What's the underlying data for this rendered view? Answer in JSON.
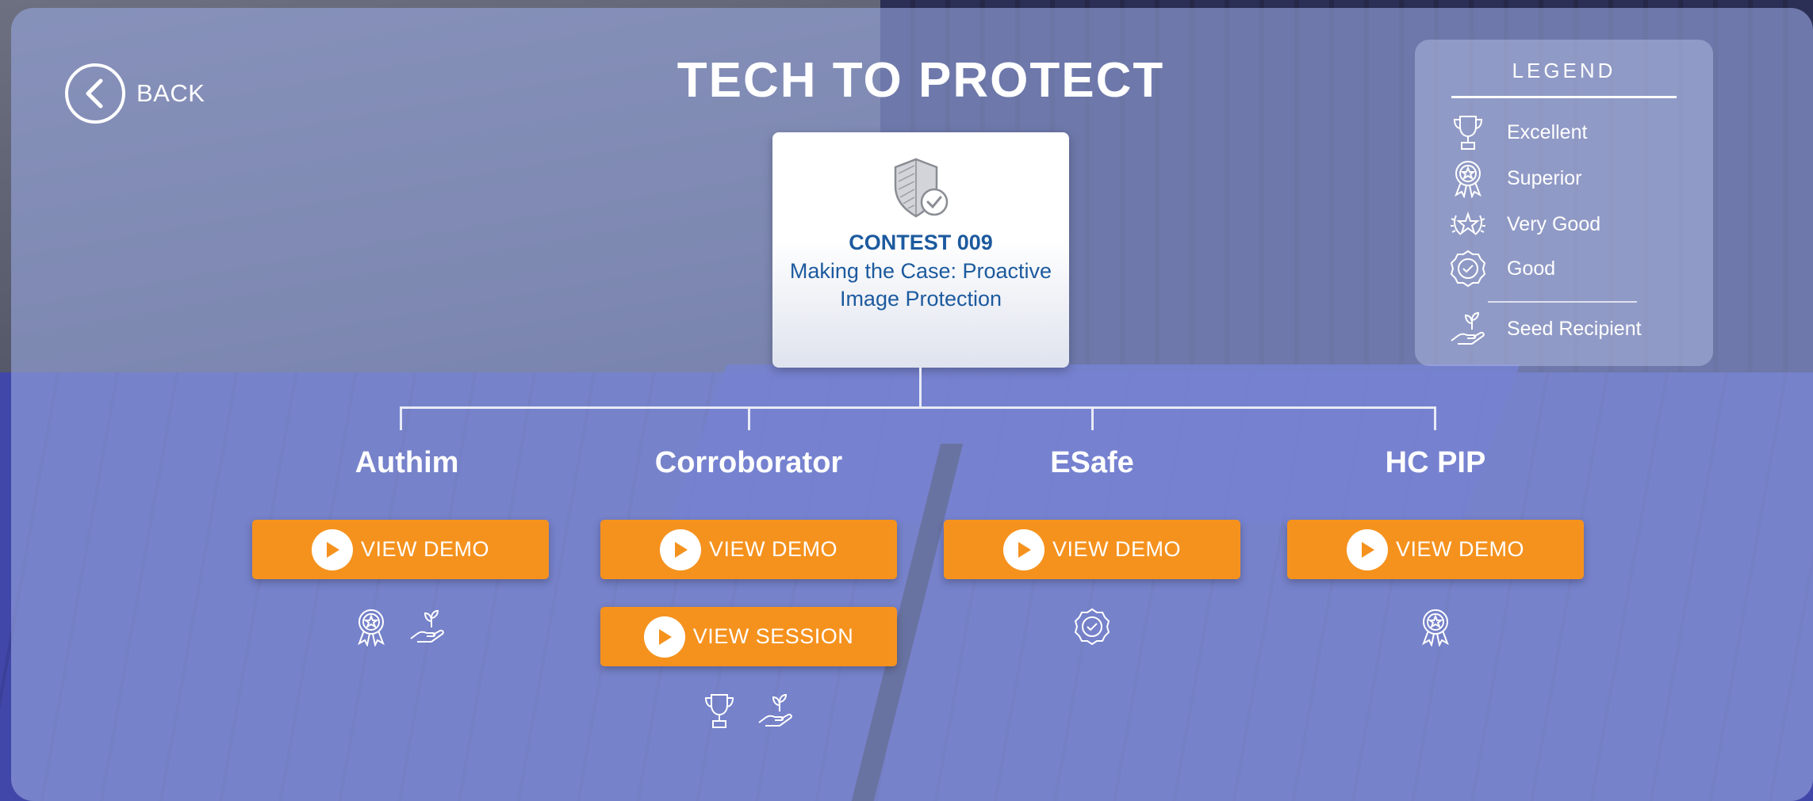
{
  "back": {
    "label": "BACK",
    "icon": "chevron-left-icon"
  },
  "title": "TECH TO PROTECT",
  "contest": {
    "number": "CONTEST 009",
    "name": "Making the Case: Proactive Image Protection",
    "icon": "shield-check-icon"
  },
  "legend": {
    "heading": "LEGEND",
    "items": [
      {
        "label": "Excellent",
        "icon": "trophy-icon"
      },
      {
        "label": "Superior",
        "icon": "ribbon-medal-icon"
      },
      {
        "label": "Very Good",
        "icon": "laurel-star-icon"
      },
      {
        "label": "Good",
        "icon": "check-seal-icon"
      },
      {
        "label": "Seed Recipient",
        "icon": "hand-seedling-icon"
      }
    ]
  },
  "teams": [
    {
      "name": "Authim",
      "demo_label": "VIEW DEMO",
      "awards": [
        "ribbon-medal-icon",
        "hand-seedling-icon"
      ]
    },
    {
      "name": "Corroborator",
      "demo_label": "VIEW DEMO",
      "session_label": "VIEW SESSION",
      "awards": [
        "trophy-icon",
        "hand-seedling-icon"
      ]
    },
    {
      "name": "ESafe",
      "demo_label": "VIEW DEMO",
      "awards": [
        "check-seal-icon"
      ]
    },
    {
      "name": "HC PIP",
      "demo_label": "VIEW DEMO",
      "awards": [
        "ribbon-medal-icon"
      ]
    }
  ],
  "colors": {
    "button": "#f5921e",
    "contest_text": "#1c5a9e",
    "panel": "#98a6de"
  }
}
